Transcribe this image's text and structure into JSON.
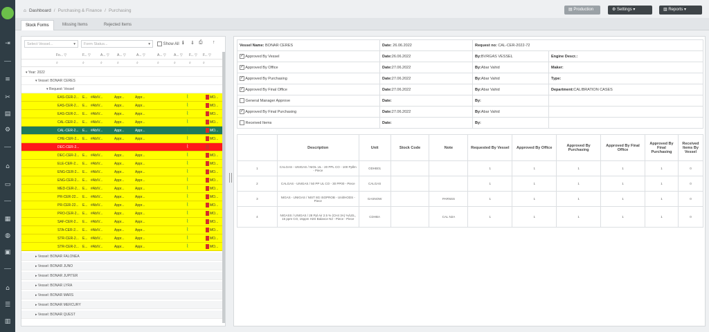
{
  "breadcrumb": {
    "home": "Dashboard",
    "section": "Purchasing & Finance",
    "current": "Purchasing"
  },
  "toolbar": {
    "production_label": "Production",
    "settings_label": "Settings",
    "reports_label": "Reports"
  },
  "tabs": [
    "Stock Forms",
    "Missing Items",
    "Rejected Items"
  ],
  "left": {
    "select_vessel_placeholder": "Select Vessel...",
    "form_status_placeholder": "Form Status...",
    "show_all_label": "Show All",
    "year_group": "Year: 2022",
    "vessel_open": "Vessel: BONAR CERES",
    "subgroup": "Request: Vessel",
    "rows": [
      {
        "code": "EAS-CER-2...",
        "c2": "E...",
        "c3": "#Ab/V...",
        "c4": "Appr...",
        "c5": "Appr...",
        "tail": "MO...",
        "style": "yellow"
      },
      {
        "code": "EAS-CER-2...",
        "c2": "E...",
        "c3": "#Ab/V...",
        "c4": "Appr...",
        "c5": "Appr...",
        "tail": "MO...",
        "style": "yellow"
      },
      {
        "code": "EAS-CER-2...",
        "c2": "E...",
        "c3": "#Ab/V...",
        "c4": "Appr...",
        "c5": "Appr...",
        "tail": "MO...",
        "style": "yellow"
      },
      {
        "code": "CAL-CER-2...",
        "c2": "E...",
        "c3": "#Ab/V...",
        "c4": "Appr...",
        "c5": "Appr...",
        "tail": "MO...",
        "style": "yellow"
      },
      {
        "code": "CAL-CER-2...",
        "c2": "E...",
        "c3": "#Ab/V...",
        "c4": "Appr...",
        "c5": "Appr...",
        "tail": "MO...",
        "style": "selected"
      },
      {
        "code": "CHE-CER-2...",
        "c2": "E...",
        "c3": "#Ab/V...",
        "c4": "Appr...",
        "c5": "Appr...",
        "tail": "MO...",
        "style": "yellow"
      },
      {
        "code": "DEC-CER-2...",
        "c2": "",
        "c3": "",
        "c4": "",
        "c5": "",
        "tail": "",
        "style": "red"
      },
      {
        "code": "DEC-CER-2...",
        "c2": "E...",
        "c3": "#Ab/V...",
        "c4": "Appr...",
        "c5": "Appr...",
        "tail": "MO...",
        "style": "yellow"
      },
      {
        "code": "ELE-CER-2...",
        "c2": "E...",
        "c3": "#Ab/V...",
        "c4": "Appr...",
        "c5": "Appr...",
        "tail": "MO...",
        "style": "yellow"
      },
      {
        "code": "ENG-CER-2...",
        "c2": "E...",
        "c3": "#Ab/V...",
        "c4": "Appr...",
        "c5": "Appr...",
        "tail": "MO...",
        "style": "yellow"
      },
      {
        "code": "ENG-CER-2...",
        "c2": "E...",
        "c3": "#Ab/V...",
        "c4": "Appr...",
        "c5": "Appr...",
        "tail": "MO...",
        "style": "yellow"
      },
      {
        "code": "MED-CER-2...",
        "c2": "E...",
        "c3": "#Ab/V...",
        "c4": "Appr...",
        "c5": "Appr...",
        "tail": "MO...",
        "style": "yellow"
      },
      {
        "code": "PR-CER-22...",
        "c2": "E...",
        "c3": "#Ab/V...",
        "c4": "Appr...",
        "c5": "Appr...",
        "tail": "MO...",
        "style": "yellow"
      },
      {
        "code": "PR-CER-22...",
        "c2": "E...",
        "c3": "#Ab/V...",
        "c4": "Appr...",
        "c5": "Appr...",
        "tail": "MO...",
        "style": "yellow"
      },
      {
        "code": "PRO-CER-2...",
        "c2": "E...",
        "c3": "#Ab/V...",
        "c4": "Appr...",
        "c5": "Appr...",
        "tail": "MO...",
        "style": "yellow"
      },
      {
        "code": "SAF-CER-2...",
        "c2": "E...",
        "c3": "#Ab/V...",
        "c4": "Appr...",
        "c5": "Appr...",
        "tail": "MO...",
        "style": "yellow"
      },
      {
        "code": "STA-CER-2...",
        "c2": "E...",
        "c3": "#Ab/V...",
        "c4": "Appr...",
        "c5": "Appr...",
        "tail": "MO...",
        "style": "yellow"
      },
      {
        "code": "STR-CER-2...",
        "c2": "E...",
        "c3": "#Ab/V...",
        "c4": "Appr...",
        "c5": "Appr...",
        "tail": "MO...",
        "style": "yellow"
      },
      {
        "code": "STR-CER-2...",
        "c2": "E...",
        "c3": "#Ab/V...",
        "c4": "Appr...",
        "c5": "Appr...",
        "tail": "MO...",
        "style": "yellow"
      }
    ],
    "collapsed_vessels": [
      "Vessel: BONAR FALONEA",
      "Vessel: BONAR JUNO",
      "Vessel: BONAR JUPITER",
      "Vessel: BONAR LYRA",
      "Vessel: BONAR MARS",
      "Vessel: BONAR MERCURY",
      "Vessel: BONAR QUEST"
    ]
  },
  "info": {
    "vessel_name_label": "Vessel Name:",
    "vessel_name": "BONAR CERES",
    "date_label": "Date:",
    "request_no_label": "Request no:",
    "request_no": "CAL-CER-2022-72",
    "by_label": "By:",
    "rows": [
      {
        "label": "Approved By Vessel",
        "checked": true,
        "date": "26.06.2022",
        "by": "BVRGAS VESSEL",
        "extra_label": "Engine Descr.:",
        "extra_value": ""
      },
      {
        "label": "Approved By Office",
        "checked": true,
        "date": "27.06.2022",
        "by": "Abar Vahid",
        "extra_label": "Maker:",
        "extra_value": ""
      },
      {
        "label": "Approved By Purchasing",
        "checked": true,
        "date": "27.06.2022",
        "by": "Abar Vahid",
        "extra_label": "Type:",
        "extra_value": ""
      },
      {
        "label": "Approved By Final Office",
        "checked": true,
        "date": "27.06.2022",
        "by": "Abar Vahid",
        "extra_label": "Department:",
        "extra_value": "CALIBRATION CASES"
      },
      {
        "label": "General Manager Approve",
        "checked": false,
        "date": "",
        "by": "",
        "extra_label": "",
        "extra_value": ""
      },
      {
        "label": "Approved By Final Purchasing",
        "checked": true,
        "date": "27.06.2022",
        "by": "Abar Vahid",
        "extra_label": "",
        "extra_value": ""
      },
      {
        "label": "Received Items",
        "checked": false,
        "date": "",
        "by": "",
        "extra_label": "",
        "extra_value": ""
      }
    ]
  },
  "items": {
    "columns": [
      "",
      "Description",
      "Unit",
      "Stock Code",
      "Note",
      "Requested By Vessel",
      "Approved By Office",
      "Approved By Purchasing",
      "Approved By Final Office",
      "Approved By Final Purchasing",
      "Received Items By Vessel"
    ],
    "rows": [
      [
        "1",
        "CALGAS - UNIGAS / NIOL UL - 20 PPL CO - 100 Ppllm - Piece",
        "ODHB01",
        "",
        "",
        "1",
        "1",
        "1",
        "1",
        "1",
        "0"
      ],
      [
        "2",
        "CALGAS - UNIGAS / 50 PP UL CO - 30 PP00 - Piece",
        "CALGAS",
        "",
        "",
        "1",
        "1",
        "1",
        "1",
        "1",
        "0"
      ],
      [
        "3",
        "NIGAS - UNIGAS / NIST 8G ISOPROB - Unit/HODS - Piece",
        "GASNOW",
        "",
        "PARNSS",
        "1",
        "1",
        "1",
        "1",
        "1",
        "0"
      ],
      [
        "4",
        "NIGASS / UNIGAS / 28 Ppl Air 2.5 % (CH4 3A) %/LEL, 15 ppm CO, 15ppm H2S Balance N2 - Piece - Piece",
        "CDHBA",
        "",
        "CAL N2A",
        "1",
        "1",
        "1",
        "1",
        "1",
        "0"
      ]
    ]
  },
  "colors": {
    "rail": "#2f3d45",
    "row_yellow": "#ffff00",
    "row_selected": "#1e7a5a",
    "row_red": "#ff1a1a",
    "logo": "#6cc04a"
  }
}
